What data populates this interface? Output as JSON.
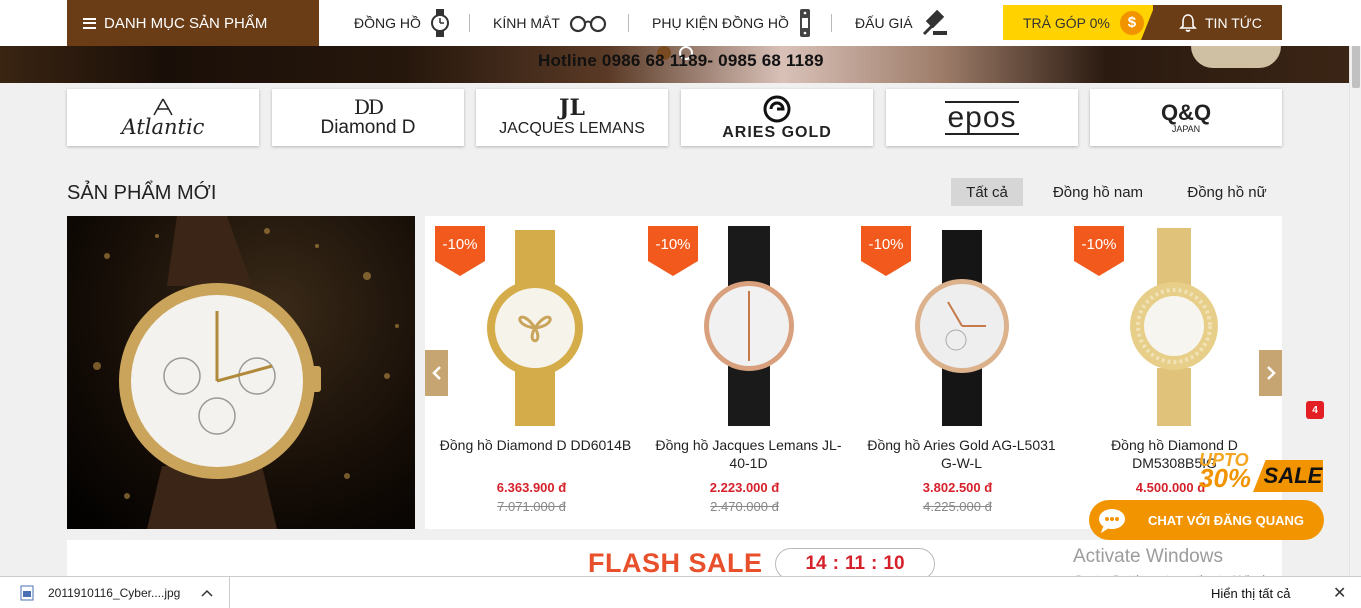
{
  "header": {
    "menu_label": "DANH MỤC SẢN PHẨM",
    "nav": [
      {
        "label": "ĐỒNG HỒ",
        "icon": "watch-icon"
      },
      {
        "label": "KÍNH MẮT",
        "icon": "glasses-icon"
      },
      {
        "label": "PHỤ KIỆN ĐỒNG HỒ",
        "icon": "watch-strap-icon"
      },
      {
        "label": "ĐẤU GIÁ",
        "icon": "auction-hammer-icon"
      }
    ],
    "installment_label": "TRẢ GÓP 0%",
    "installment_icon": "$",
    "news_label": "TIN TỨC"
  },
  "banner": {
    "hotline": "Hotline 0986 68 1189- 0985 68 1189"
  },
  "brands": [
    {
      "name": "Atlantic",
      "sub": "",
      "mark": "Λ"
    },
    {
      "name": "Diamond D",
      "sub": "",
      "mark": "DD"
    },
    {
      "name": "JACQUES LEMANS",
      "sub": "",
      "mark": "JL"
    },
    {
      "name": "ARIES GOLD",
      "sub": "",
      "mark": "G"
    },
    {
      "name": "epos",
      "sub": "",
      "mark": ""
    },
    {
      "name": "Q&Q",
      "sub": "JAPAN",
      "mark": ""
    }
  ],
  "section": {
    "title": "SẢN PHẨM MỚI",
    "tabs": [
      "Tất cả",
      "Đồng hồ nam",
      "Đồng hồ nữ"
    ],
    "active_tab": "Tất cả"
  },
  "products": [
    {
      "discount": "-10%",
      "name": "Đồng hồ Diamond D DD6014B",
      "price": "6.363.900 đ",
      "old_price": "7.071.000 đ"
    },
    {
      "discount": "-10%",
      "name": "Đồng hồ Jacques Lemans JL-40-1D",
      "price": "2.223.000 đ",
      "old_price": "2.470.000 đ"
    },
    {
      "discount": "-10%",
      "name": "Đồng hồ Aries Gold AG-L5031 G-W-L",
      "price": "3.802.500 đ",
      "old_price": "4.225.000 đ"
    },
    {
      "discount": "-10%",
      "name": "Đồng hồ Diamond D DM5308B5IG",
      "price": "4.500.000 đ",
      "old_price": ""
    }
  ],
  "flash": {
    "title": "FLASH SALE",
    "hours": "14",
    "minutes": "11",
    "seconds": "10"
  },
  "promo": {
    "upto": "UPTO",
    "percent": "30%",
    "sale": "SALE",
    "badge": "4",
    "chat_label": "CHAT VỚI ĐĂNG QUANG"
  },
  "windows": {
    "activate_title": "Activate Windows",
    "activate_sub": "Go to Settings to activate Windows."
  },
  "download_bar": {
    "file_name": "2011910116_Cyber....jpg",
    "show_all": "Hiển thị tất cả"
  },
  "colors": {
    "brown": "#6b3d17",
    "yellow": "#ffd200",
    "orange": "#f29400",
    "red": "#d6212b",
    "discount": "#f25a1d"
  }
}
